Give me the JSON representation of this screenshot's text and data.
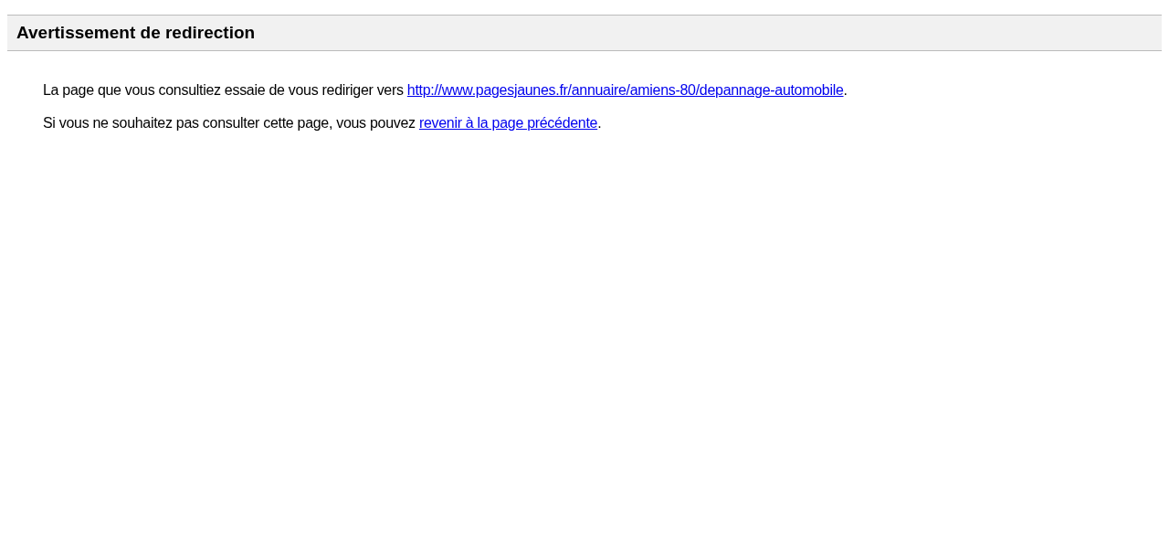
{
  "header": {
    "title": "Avertissement de redirection"
  },
  "paragraphs": [
    {
      "before": "La page que vous consultiez essaie de vous rediriger vers ",
      "link": "http://www.pagesjaunes.fr/annuaire/amiens-80/depannage-automobile",
      "after": "."
    },
    {
      "before": "Si vous ne souhaitez pas consulter cette page, vous pouvez ",
      "link": "revenir à la page précédente",
      "after": "."
    }
  ]
}
